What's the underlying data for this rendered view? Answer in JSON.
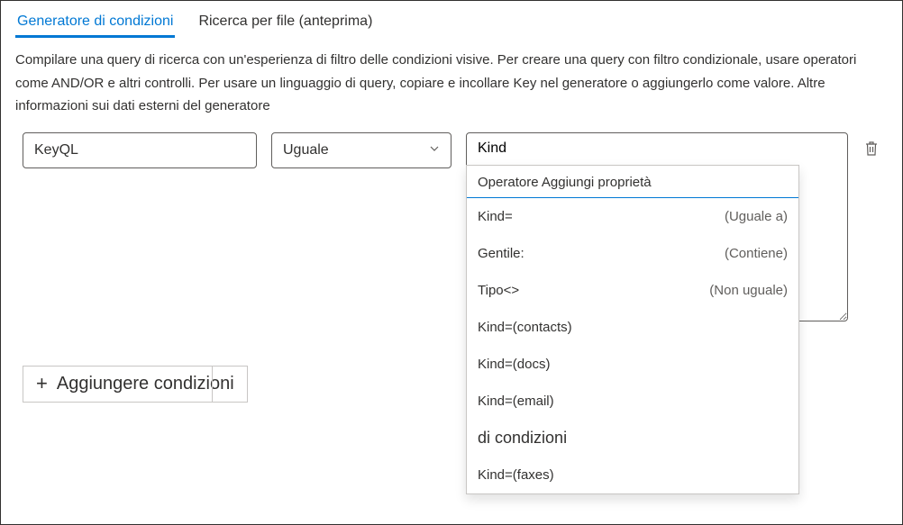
{
  "tabs": {
    "builder": "Generatore di condizioni",
    "fileSearch": "Ricerca per file (anteprima)"
  },
  "description": "Compilare una query di ricerca con un'esperienza di filtro delle condizioni visive. Per creare una query con filtro condizionale, usare operatori come AND/OR e altri controlli. Per usare un linguaggio di query, copiare e incollare Key nel generatore o aggiungerlo come valore. Altre informazioni sui dati esterni del generatore",
  "condition": {
    "propertyValue": "KeyQL",
    "operatorLabel": "Uguale",
    "valueText": "Kind"
  },
  "dropdown": {
    "header": "Operatore Aggiungi proprietà",
    "items": [
      {
        "label": "Kind=",
        "hint": "(Uguale a)"
      },
      {
        "label": "Gentile:",
        "hint": "(Contiene)"
      },
      {
        "label": "Tipo<>",
        "hint": "(Non uguale)"
      },
      {
        "label": "Kind=(contacts)",
        "hint": ""
      },
      {
        "label": "Kind=(docs)",
        "hint": ""
      },
      {
        "label": "Kind=(email)",
        "hint": ""
      }
    ],
    "sectionLabel": "di condizioni",
    "trailing": [
      {
        "label": "Kind=(faxes)",
        "hint": ""
      }
    ]
  },
  "addConditionsLabel": "Aggiungere condizioni"
}
